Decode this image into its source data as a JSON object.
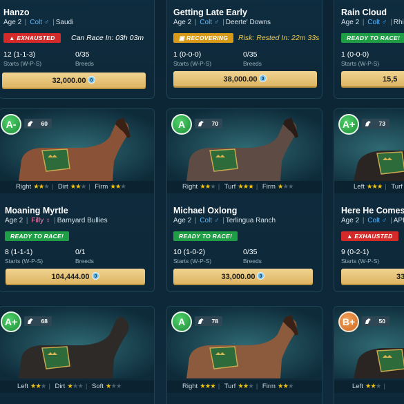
{
  "cards": [
    {
      "name": "Hanzo",
      "age": "Age 2",
      "sex": "Colt",
      "sex_symbol": "♂",
      "stable": "Saudi",
      "status": "EXHAUSTED",
      "status_type": "exhausted",
      "status_note": "Can Race In: 03h 03m",
      "starts": "12 (1-1-3)",
      "starts_label": "Starts (W-P-S)",
      "breeds": "0/35",
      "breeds_label": "Breeds",
      "price": "32,000.00"
    },
    {
      "name": "Getting Late Early",
      "age": "Age 2",
      "sex": "Colt",
      "sex_symbol": "♂",
      "stable": "Deerte' Downs",
      "status": "RECOVERING",
      "status_type": "recovering",
      "status_note": "Risk: Rested In: 22m 33s",
      "starts": "1 (0-0-0)",
      "starts_label": "Starts (W-P-S)",
      "breeds": "0/35",
      "breeds_label": "Breeds",
      "price": "38,000.00"
    },
    {
      "name": "Rain Cloud",
      "age": "Age 2",
      "sex": "Colt",
      "sex_symbol": "♂",
      "stable": "Rhine",
      "status": "READY TO RACE!",
      "status_type": "ready",
      "starts": "1 (0-0-0)",
      "starts_label": "Starts (W-P-S)",
      "price": "15,5"
    },
    {
      "grade": "A-",
      "rating": "60",
      "surfaces": [
        {
          "label": "Right",
          "stars": 2.5
        },
        {
          "label": "Dirt",
          "stars": 2
        },
        {
          "label": "Firm",
          "stars": 2.5
        }
      ],
      "name": "Moaning Myrtle",
      "age": "Age 2",
      "sex": "Filly",
      "sex_symbol": "♀",
      "stable": "Barnyard Bullies",
      "status": "READY TO RACE!",
      "status_type": "ready",
      "starts": "8 (1-1-1)",
      "starts_label": "Starts (W-P-S)",
      "breeds": "0/1",
      "breeds_label": "Breeds",
      "price": "104,444.00"
    },
    {
      "grade": "A",
      "rating": "70",
      "surfaces": [
        {
          "label": "Right",
          "stars": 2.5
        },
        {
          "label": "Turf",
          "stars": 3
        },
        {
          "label": "Firm",
          "stars": 1.5
        }
      ],
      "name": "Michael Oxlong",
      "age": "Age 2",
      "sex": "Colt",
      "sex_symbol": "♂",
      "stable": "Terlingua Ranch",
      "status": "READY TO RACE!",
      "status_type": "ready",
      "starts": "10 (1-0-2)",
      "starts_label": "Starts (W-P-S)",
      "breeds": "0/35",
      "breeds_label": "Breeds",
      "price": "33,000.00"
    },
    {
      "grade": "A+",
      "rating": "73",
      "surfaces": [
        {
          "label": "Left",
          "stars": 3
        },
        {
          "label": "Turf",
          "stars": 2.5
        }
      ],
      "name": "Here He Comes",
      "age": "Age 2",
      "sex": "Colt",
      "sex_symbol": "♂",
      "stable": "APB",
      "status": "EXHAUSTED",
      "status_type": "exhausted",
      "starts": "9 (0-2-1)",
      "starts_label": "Starts (W-P-S)",
      "price": "33,0"
    },
    {
      "grade": "A+",
      "rating": "68",
      "surfaces": [
        {
          "label": "Left",
          "stars": 1.5
        },
        {
          "label": "Dirt",
          "stars": 1
        },
        {
          "label": "Soft",
          "stars": 1
        }
      ]
    },
    {
      "grade": "A",
      "rating": "78",
      "surfaces": [
        {
          "label": "Right",
          "stars": 3
        },
        {
          "label": "Turf",
          "stars": 2.5
        },
        {
          "label": "Firm",
          "stars": 2.5
        }
      ]
    },
    {
      "grade": "B+",
      "rating": "50",
      "surfaces": [
        {
          "label": "Left",
          "stars": 1.5
        }
      ]
    }
  ],
  "colors": {
    "background": "#0d2535",
    "card_border": "#1d4356",
    "exhausted": "#d42a2a",
    "recovering": "#d99a1a",
    "ready": "#1f9e46",
    "price_gold": "#dcb25e",
    "star_gold": "#f1c40f",
    "grade_green": "#2fae4a",
    "grade_orange": "#e07a2c"
  }
}
